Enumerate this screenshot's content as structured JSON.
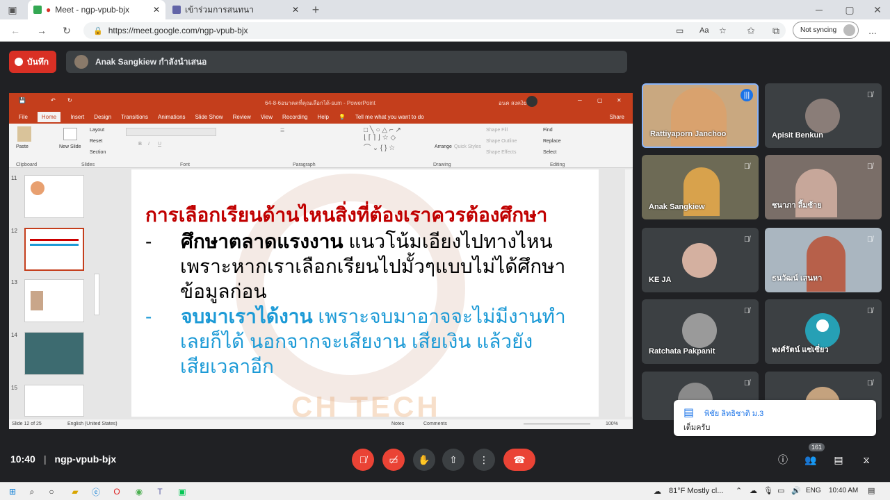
{
  "browser": {
    "tabs": [
      {
        "title": "Meet - ngp-vpub-bjx"
      },
      {
        "title": "เข้าร่วมการสนทนา"
      }
    ],
    "new_tab": "+",
    "url": "https://meet.google.com/ngp-vpub-bjx",
    "read_aloud": "Aa",
    "sync_label": "Not syncing",
    "menu": "..."
  },
  "meet": {
    "record_label": "บันทึก",
    "presenting_label": "Anak Sangkiew กำลังนำเสนอ",
    "time": "10:40",
    "meeting_code": "ngp-vpub-bjx",
    "participant_count": "161",
    "participants": [
      {
        "name": "Rattiyaporn Janchoo",
        "speaking": true
      },
      {
        "name": "Apisit Benkun"
      },
      {
        "name": "Anak Sangkiew"
      },
      {
        "name": "ชนาภา ลิ้มซ้าย"
      },
      {
        "name": "KE JA"
      },
      {
        "name": "ธนวัฒน์ เสนหา"
      },
      {
        "name": "Ratchata Pakpanit"
      },
      {
        "name": "พงศ์รัตน์ แซ่เซี่ยว"
      },
      {
        "name": ""
      },
      {
        "name": ""
      }
    ],
    "chat_notification": {
      "sender": "พิชัย ลิทธิชาติ ม.3",
      "message": "เต็มครับ"
    }
  },
  "powerpoint": {
    "window_title": "64-8-6อนาคตที่คุณเลือกได้-sum - PowerPoint",
    "user": "อนค สงคงิยว",
    "menu": [
      "File",
      "Home",
      "Insert",
      "Design",
      "Transitions",
      "Animations",
      "Slide Show",
      "Review",
      "View",
      "Recording",
      "Help"
    ],
    "tell_me": "Tell me what you want to do",
    "share": "Share",
    "ribbon": {
      "paste": "Paste",
      "new_slide": "New Slide",
      "layout": "Layout",
      "reset": "Reset",
      "section": "Section",
      "arrange": "Arrange",
      "quick_styles": "Quick Styles",
      "shape_fill": "Shape Fill",
      "shape_outline": "Shape Outline",
      "shape_effects": "Shape Effects",
      "find": "Find",
      "replace": "Replace",
      "select": "Select",
      "groups": [
        "Clipboard",
        "Slides",
        "Font",
        "Paragraph",
        "Drawing",
        "Editing"
      ]
    },
    "slide_numbers": [
      "11",
      "12",
      "13",
      "14",
      "15"
    ],
    "status": {
      "slide_info": "Slide 12 of 25",
      "language": "English (United States)",
      "notes": "Notes",
      "comments": "Comments",
      "zoom": "100%"
    },
    "slide": {
      "heading": "การเลือกเรียนด้านไหนสิ่งที่ต้องเราควรต้องศึกษา",
      "bullet1_bold": "ศึกษาตลาดแรงงาน",
      "bullet1_text": " แนวโน้มเอียงไปทางไหน",
      "bullet1_line2": "เพราะหากเราเลือกเรียนไปมั้วๆแบบไม่ได้ศึกษา",
      "bullet1_line3": "ข้อมูลก่อน",
      "bullet2_bold": "จบมาเราได้งาน",
      "bullet2_text": " เพราะจบมาอาจจะไม่มีงานทำ",
      "bullet2_line2": "เลยก็ได้ นอกจากจะเสียงาน เสียเงิน แล้วยัง",
      "bullet2_line3": "เสียเวลาอีก",
      "dash": "-",
      "watermark_text": "CH TECH"
    }
  },
  "taskbar": {
    "weather": "81°F  Mostly cl...",
    "lang": "ENG",
    "time": "10:40 AM"
  },
  "colors": {
    "meet_bg": "#202124",
    "red": "#ea4335",
    "ppt_orange": "#c43e1c",
    "slide_red": "#c00000",
    "slide_blue": "#1c9ad6"
  }
}
